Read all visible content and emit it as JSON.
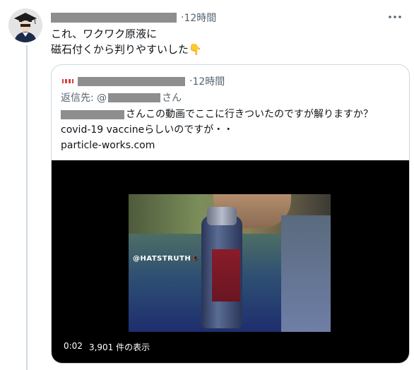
{
  "tweet": {
    "time": "12時間",
    "text_line1": "これ、ワクワク原液に",
    "text_line2": "磁石付くから判りやすいした",
    "emoji": "👇"
  },
  "quoted_tweet": {
    "time": "12時間",
    "reply_to_prefix": "返信先: @",
    "reply_to_suffix": "さん",
    "body_line1_suffix": "さんこの動画でここに行きついたのですが解りますか？",
    "body_line2": "covid-19 vaccineらしいのですが・・",
    "body_line3": "particle-works.com"
  },
  "video": {
    "watermark": "@HATSTRUTH",
    "elapsed": "0:02",
    "view_count": "3,901 件の表示"
  },
  "icons": {
    "more": "more-horizontal-icon"
  }
}
